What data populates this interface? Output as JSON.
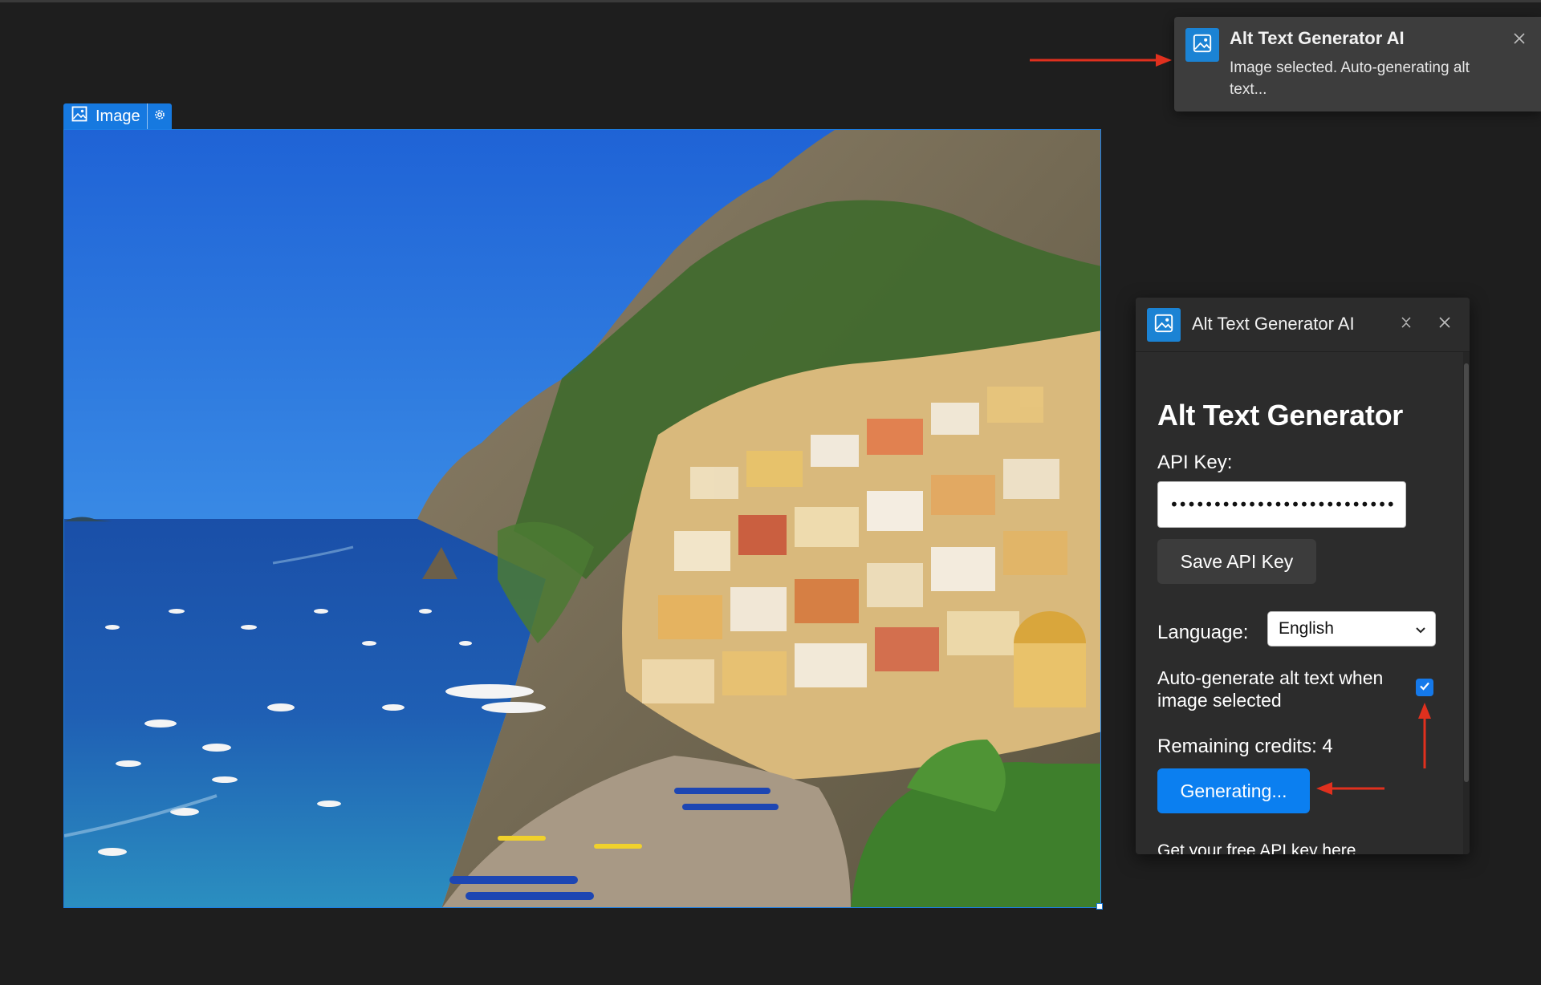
{
  "image_element": {
    "tag_label": "Image",
    "tag_icon": "image-icon",
    "settings_icon": "gear-icon",
    "selection_color": "#1c7fe6"
  },
  "toast": {
    "title": "Alt Text Generator AI",
    "message": "Image selected. Auto-generating alt text...",
    "icon": "image-icon",
    "close_icon": "close-icon"
  },
  "panel": {
    "title": "Alt Text Generator AI",
    "icon": "image-icon",
    "minimize_icon": "collapse-icon",
    "close_icon": "close-icon",
    "heading": "Alt Text Generator",
    "api_key_label": "API Key:",
    "api_key_value": "••••••••••••••••••••••••••",
    "save_button": "Save API Key",
    "language_label": "Language:",
    "language_selected": "English",
    "auto_generate_label": "Auto-generate alt text when image selected",
    "auto_generate_checked": true,
    "remaining_credits_label": "Remaining credits: 4",
    "generate_button": "Generating...",
    "link_text": "Get your free API key here"
  },
  "colors": {
    "background": "#1e1e1e",
    "panel_bg": "#2c2c2c",
    "accent_blue": "#0b7ff0",
    "annotation_red": "#e0301e"
  }
}
